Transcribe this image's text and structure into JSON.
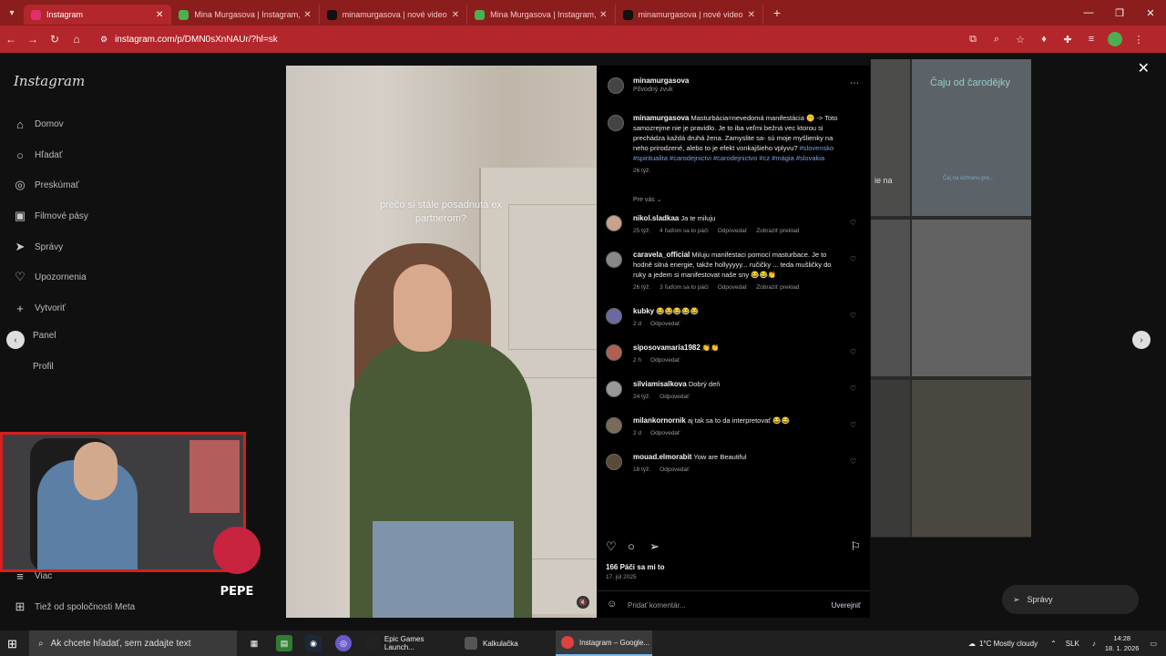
{
  "browser": {
    "tabs": [
      {
        "label": "Instagram",
        "active": true,
        "icon_color": "#e1306c"
      },
      {
        "label": "Mina Murgasova | Instagram,",
        "active": false,
        "icon_color": "#4caf50"
      },
      {
        "label": "minamurgasova | nové video n",
        "active": false,
        "icon_color": "#111111"
      },
      {
        "label": "Mina Murgasova | Instagram,",
        "active": false,
        "icon_color": "#4caf50"
      },
      {
        "label": "minamurgasova | nové video n",
        "active": false,
        "icon_color": "#111111"
      }
    ],
    "url": "instagram.com/p/DMN0sXnNAUr/?hl=sk"
  },
  "sidebar": {
    "logo": "Instagram",
    "items": [
      {
        "label": "Domov",
        "icon": "home-icon",
        "glyph": "⌂"
      },
      {
        "label": "Hľadať",
        "icon": "search-icon",
        "glyph": "○"
      },
      {
        "label": "Preskúmať",
        "icon": "compass-icon",
        "glyph": "◎"
      },
      {
        "label": "Filmové pásy",
        "icon": "reels-icon",
        "glyph": "▣"
      },
      {
        "label": "Správy",
        "icon": "send-icon",
        "glyph": "➤"
      },
      {
        "label": "Upozornenia",
        "icon": "heart-icon",
        "glyph": "♡"
      },
      {
        "label": "Vytvoriť",
        "icon": "plus-icon",
        "glyph": "+"
      },
      {
        "label": "Panel",
        "icon": "dashboard-icon",
        "glyph": "▤"
      },
      {
        "label": "Profil",
        "icon": "profile-icon",
        "glyph": "●"
      }
    ],
    "more": "Viac",
    "meta": "Tiež od spoločnosti Meta"
  },
  "post": {
    "video_caption": "prečo si stále posadnutá ex partnerom?",
    "author": "minamurgasova",
    "audio": "Pôvodný zvuk",
    "caption_text": "Masturbácia=nevedomá manifestácia 🤫 -> Toto samozrejme nie je pravidlo. Je to iba veľmi bežná vec ktorou si prechádza každá druhá žena. Zamyslite sa- sú moje myšlienky na neho prirodzené, alebo to je efekt vonkajšieho vplyvu?",
    "caption_tags": "#slovensko #spiritualita #carodejnictvi #carodejnictvo #cz #mágia #slovakia",
    "caption_time": "26 týž.",
    "for_you": "Pre vás",
    "likes": "166 Páči sa mi to",
    "date": "17. júl 2025",
    "comment_placeholder": "Pridať komentár...",
    "publish": "Uverejniť"
  },
  "comments": [
    {
      "user": "nikol.sladkaa",
      "text": "Ja te miluju",
      "time": "25 týž.",
      "likes": "4 ľuďom sa to páči",
      "reply": "Odpovedať",
      "translate": "Zobraziť preklad"
    },
    {
      "user": "caravela_official",
      "text": "Miluju manifestaci pomocí masturbace. Je to hodně silná energie, takže hollyyyyy... ručičky ... teda mušličky do ruky a jedem si manifestovat naše sny 😂😂👏",
      "time": "26 týž.",
      "likes": "3 ľuďom sa to páči",
      "reply": "Odpovedať",
      "translate": "Zobraziť preklad"
    },
    {
      "user": "kubky",
      "text": "😂😂😂😂😂",
      "time": "2 d",
      "likes": "",
      "reply": "Odpovedať",
      "translate": ""
    },
    {
      "user": "siposovamaria1982",
      "text": "👏👏",
      "time": "2 h",
      "likes": "",
      "reply": "Odpovedať",
      "translate": ""
    },
    {
      "user": "silviamisalkova",
      "text": "Dobrý deň",
      "time": "24 týž.",
      "likes": "",
      "reply": "Odpovedať",
      "translate": ""
    },
    {
      "user": "milankornornik",
      "text": "aj tak sa to da interpretovať 😂😂",
      "time": "2 d",
      "likes": "",
      "reply": "Odpovedať",
      "translate": ""
    },
    {
      "user": "mouad.elmorabit",
      "text": "Yow are Beautiful",
      "time": "18 týž.",
      "likes": "",
      "reply": "Odpovedať",
      "translate": ""
    }
  ],
  "backdrop": {
    "thumb_title": "Čaju od čarodějky",
    "thumb_partial": "ie na",
    "thumb_small": "Čaj na ochranu pre...",
    "messages_pill": "Správy"
  },
  "overlay": {
    "pepe_label": "PEPE"
  },
  "taskbar": {
    "search_placeholder": "Ak chcete hľadať, sem zadajte text",
    "apps": [
      {
        "label": "Epic Games Launch...",
        "active": false,
        "icon_color": "#222222"
      },
      {
        "label": "Kalkulačka",
        "active": false,
        "icon_color": "#555555"
      },
      {
        "label": "Instagram – Google...",
        "active": true,
        "icon_color": "#e04040"
      }
    ],
    "weather": "1°C  Mostly cloudy",
    "lang": "SLK",
    "time": "14:28",
    "date": "18. 1. 2026"
  }
}
